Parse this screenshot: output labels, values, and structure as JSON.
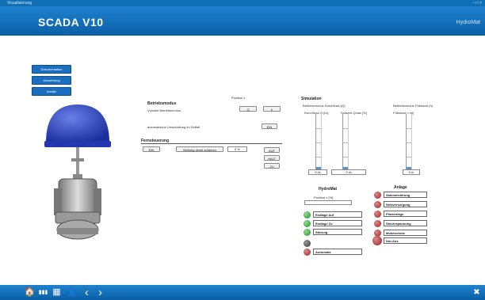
{
  "window": {
    "title": "Visualisierung",
    "controls": "– □ ×"
  },
  "header": {
    "logo": "SCADA V10",
    "brand": "HydroMat"
  },
  "nav": [
    {
      "label": "Dokumentation"
    },
    {
      "label": "Auswertung"
    },
    {
      "label": "Kanäle"
    }
  ],
  "mode": {
    "heading": "Betriebsmodus",
    "position_label": "Position x",
    "control_label": "Vorwahl Betriebsmodus",
    "q_label": "Q",
    "h_label": "h",
    "auto_label": "automatische Umschaltung im Notfall",
    "auto_button": "EIN"
  },
  "setpoint": {
    "heading": "Fernsteuerung",
    "on_button": "EIN",
    "opening_button": "Stellung direkt anfahren",
    "value": "0 %",
    "auf": "AUF",
    "halt": "HALT",
    "zu": "ZU"
  },
  "simulation": {
    "heading": "Simulation",
    "sub_q": "Betriebsmodus Durchfluss (Q)",
    "sub_h": "Betriebsmodus Füllstand (h)",
    "col1": "Durchfluss Q [l/s]",
    "col2": "Sollwert Qmax [%]",
    "col3": "Füllstand h [m]",
    "v1": "0 l/s",
    "v2": "0 l/s",
    "v3": "0 m",
    "fill1": 0.05,
    "fill2": 0.05,
    "fill3": 0.05
  },
  "hydromat": {
    "heading": "HydroMat",
    "position_label": "Position x [%]",
    "items": [
      {
        "label": "Endlage Auf",
        "color": "green"
      },
      {
        "label": "Endlage Zu",
        "color": "green"
      },
      {
        "label": "Störung",
        "color": "green"
      },
      {
        "label": "",
        "color": "gray"
      },
      {
        "label": "Automatik",
        "color": "red"
      }
    ]
  },
  "anlage": {
    "heading": "Anlage",
    "items": [
      {
        "label": "Sammelstörung",
        "color": "red"
      },
      {
        "label": "Netzversorgung",
        "color": "red"
      },
      {
        "label": "Phasenlage",
        "color": "red"
      },
      {
        "label": "Steuerspannung",
        "color": "red"
      },
      {
        "label": "Motorschutz",
        "color": "red"
      },
      {
        "label": "Not-Aus",
        "color": "red"
      }
    ]
  },
  "footer": {
    "icons": [
      "home-icon",
      "device-icon",
      "grid-icon",
      "user-icon",
      "back-icon",
      "forward-icon"
    ],
    "home": "🏠",
    "device": "▮▮▮",
    "grid": "▦",
    "user": "👤",
    "back": "‹",
    "forward": "›",
    "close": "✖"
  }
}
